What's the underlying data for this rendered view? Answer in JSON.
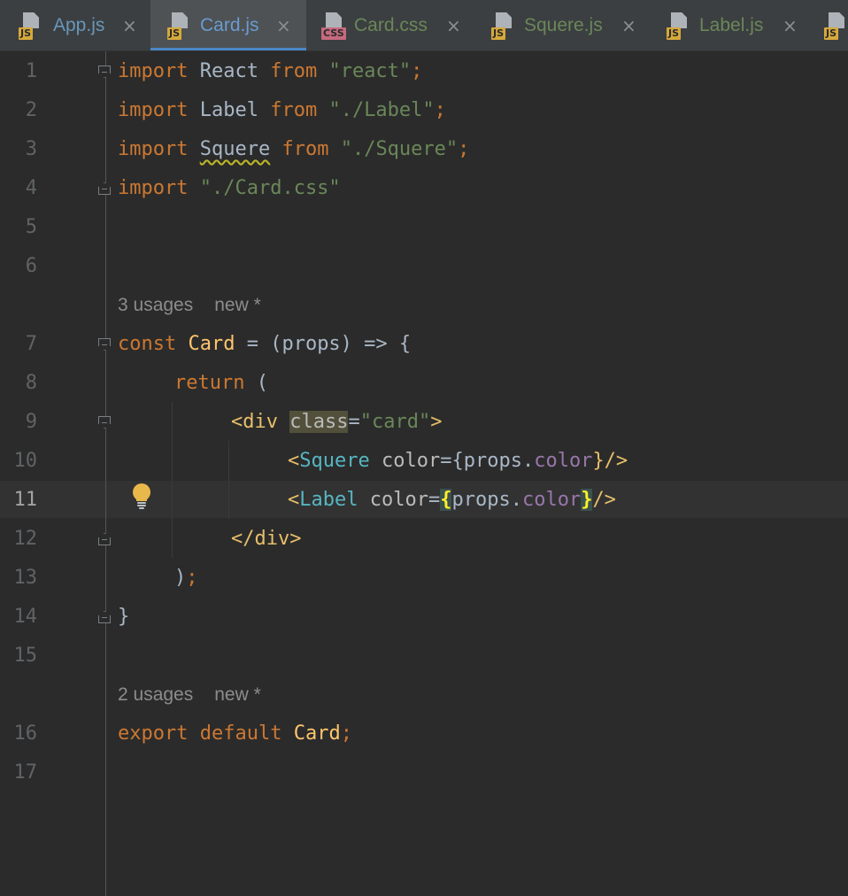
{
  "tabs": [
    {
      "label": "App.js",
      "badge": "JS",
      "close": "×",
      "active": false,
      "color": "#6897bb"
    },
    {
      "label": "Card.js",
      "badge": "JS",
      "close": "×",
      "active": true,
      "color": "#6a9bd0"
    },
    {
      "label": "Card.css",
      "badge": "CSS",
      "close": "×",
      "active": false,
      "color": "#6a8759"
    },
    {
      "label": "Squere.js",
      "badge": "JS",
      "close": "×",
      "active": false,
      "color": "#6a8759"
    },
    {
      "label": "Label.js",
      "badge": "JS",
      "close": "×",
      "active": false,
      "color": "#6a8759"
    },
    {
      "label": "",
      "badge": "JS",
      "close": "",
      "active": false,
      "color": "#6a8759"
    }
  ],
  "line_numbers": [
    "1",
    "2",
    "3",
    "4",
    "5",
    "6",
    "7",
    "8",
    "9",
    "10",
    "11",
    "12",
    "13",
    "14",
    "15",
    "16",
    "17"
  ],
  "current_line": "11",
  "code": {
    "l1": {
      "t1": "import",
      "t2": "React",
      "t3": "from",
      "t4": "\"react\"",
      "t5": ";"
    },
    "l2": {
      "t1": "import",
      "t2": "Label",
      "t3": "from",
      "t4": "\"./Label\"",
      "t5": ";"
    },
    "l3": {
      "t1": "import",
      "t2": "Squere",
      "t3": "from",
      "t4": "\"./Squere\"",
      "t5": ";"
    },
    "l4": {
      "t1": "import",
      "t2": "\"./Card.css\""
    },
    "l7": {
      "t1": "const",
      "t2": "Card",
      "t3": "= (props) => {"
    },
    "l8": {
      "t1": "return",
      "t2": "("
    },
    "l9": {
      "t1": "<div",
      "t2": "class",
      "t3": "=",
      "t4": "\"card\"",
      "t5": ">"
    },
    "l10": {
      "t1": "<",
      "t2": "Squere",
      "t3": "color",
      "t4": "={",
      "t5": "props.",
      "t6": "color",
      "t7": "}/>"
    },
    "l11": {
      "t1": "<",
      "t2": "Label",
      "t3": "color",
      "t4": "=",
      "t5": "{",
      "t6": "props.",
      "t7": "color",
      "t8": "}",
      "t9": "/>"
    },
    "l12": {
      "t1": "</div>"
    },
    "l13": {
      "t1": ")",
      "t2": ";"
    },
    "l14": {
      "t1": "}"
    },
    "l16": {
      "t1": "export",
      "t2": "default",
      "t3": "Card",
      "t4": ";"
    }
  },
  "inlay_hints": {
    "card_const": {
      "usages": "3 usages",
      "status": "new *"
    },
    "card_export": {
      "usages": "2 usages",
      "status": "new *"
    }
  },
  "icons": {
    "bulb": "lightbulb-icon",
    "close": "close-icon",
    "file_js": "js-file-icon",
    "file_css": "css-file-icon"
  },
  "colors": {
    "background": "#2b2b2b",
    "tabbar": "#3c3f41",
    "active_tab_underline": "#4a88c7",
    "keyword": "#cc7832",
    "string": "#6a8759",
    "class_name": "#ffc66d",
    "jsx_component": "#56b6c2",
    "property": "#9876aa",
    "brace_match": "#ffef28",
    "bulb": "#e9b84a"
  }
}
